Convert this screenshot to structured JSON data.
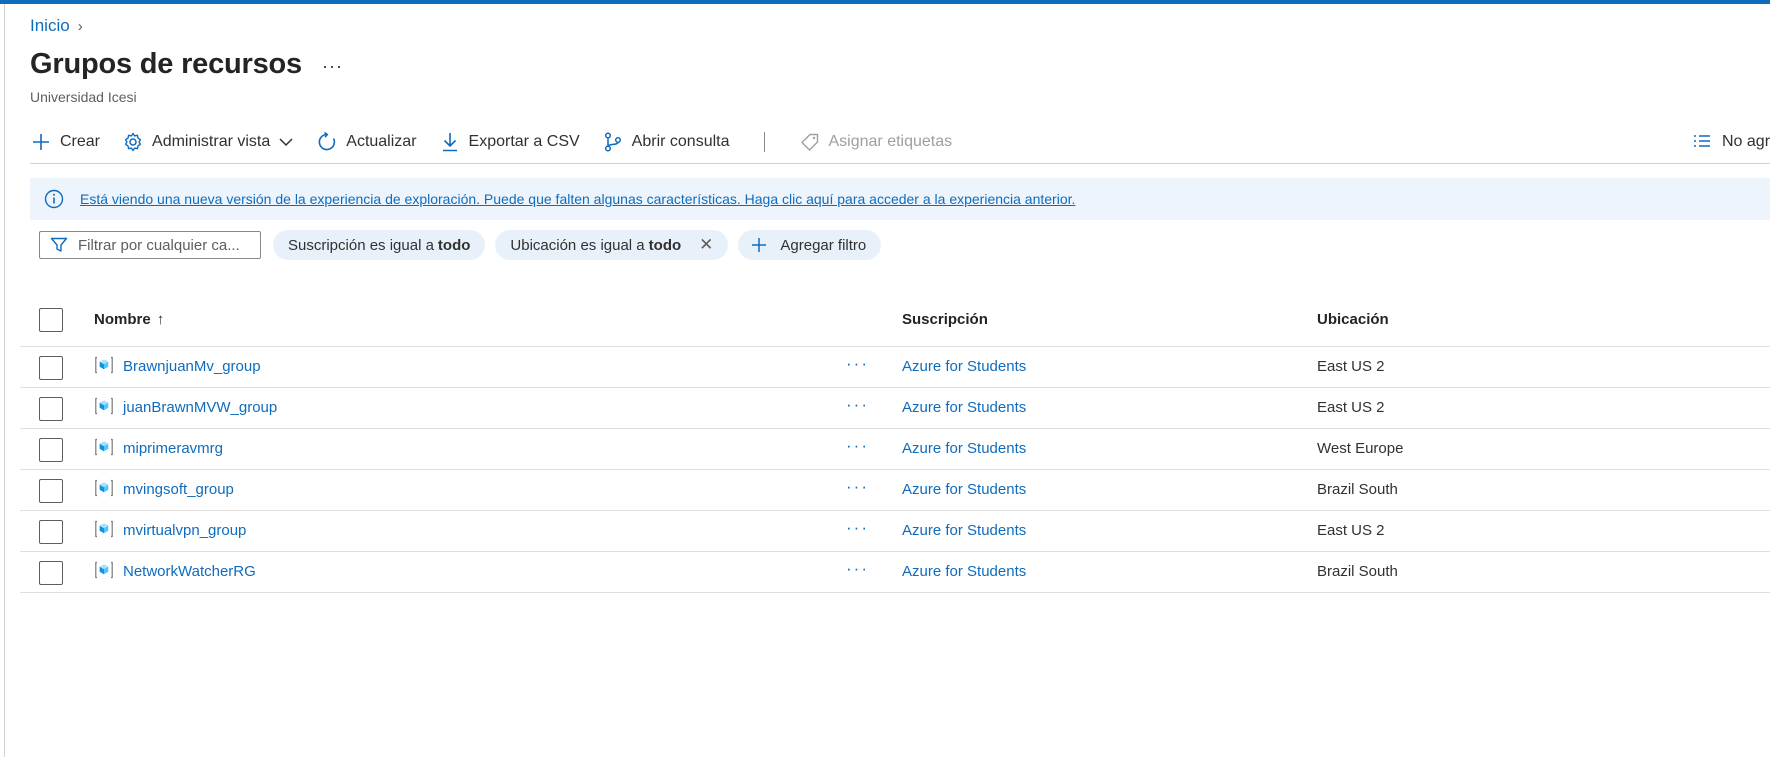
{
  "breadcrumb": {
    "home": "Inicio",
    "separator": "›"
  },
  "page": {
    "title": "Grupos de recursos",
    "more": "···",
    "subtitle": "Universidad Icesi"
  },
  "toolbar": {
    "create": "Crear",
    "manage_view": "Administrar vista",
    "refresh": "Actualizar",
    "export_csv": "Exportar a CSV",
    "open_query": "Abrir consulta",
    "assign_tags": "Asignar etiquetas",
    "grouping": "No agr"
  },
  "banner": {
    "text": "Está viendo una nueva versión de la experiencia de exploración. Puede que falten algunas características. Haga clic aquí para acceder a la experiencia anterior."
  },
  "filters": {
    "search_placeholder": "Filtrar por cualquier ca...",
    "pills": [
      {
        "label": "Suscripción es igual a",
        "value": "todo"
      },
      {
        "label": "Ubicación es igual a",
        "value": "todo"
      }
    ],
    "remove_symbol": "✕",
    "add_filter": "Agregar filtro"
  },
  "table": {
    "columns": {
      "name": "Nombre",
      "name_sort": "↑",
      "subscription": "Suscripción",
      "location": "Ubicación"
    },
    "more_symbol": "···",
    "rows": [
      {
        "name": "BrawnjuanMv_group",
        "subscription": "Azure for Students",
        "location": "East US 2"
      },
      {
        "name": "juanBrawnMVW_group",
        "subscription": "Azure for Students",
        "location": "East US 2"
      },
      {
        "name": "miprimeravmrg",
        "subscription": "Azure for Students",
        "location": "West Europe"
      },
      {
        "name": "mvingsoft_group",
        "subscription": "Azure for Students",
        "location": "Brazil South"
      },
      {
        "name": "mvirtualvpn_group",
        "subscription": "Azure for Students",
        "location": "East US 2"
      },
      {
        "name": "NetworkWatcherRG",
        "subscription": "Azure for Students",
        "location": "Brazil South"
      }
    ]
  },
  "colors": {
    "accent": "#0f6cbd",
    "banner_bg": "#eef4fb",
    "pill_bg": "#e8f1fa",
    "resource_icon": "#1490df"
  }
}
